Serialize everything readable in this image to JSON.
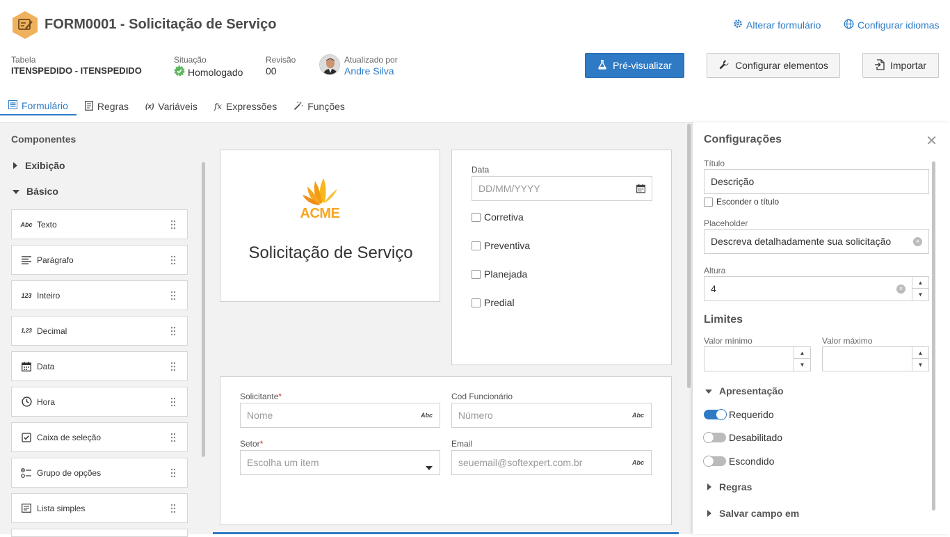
{
  "header": {
    "title": "FORM0001 - Solicitação de Serviço",
    "links": {
      "alterar": "Alterar formulário",
      "idiomas": "Configurar idiomas"
    },
    "table_label": "Tabela",
    "table_value": "ITENSPEDIDO - ITENSPEDIDO",
    "status_label": "Situação",
    "status_value": "Homologado",
    "revision_label": "Revisão",
    "revision_value": "00",
    "updated_label": "Atualizado por",
    "updated_value": "Andre Silva",
    "buttons": {
      "preview": "Pré-visualizar",
      "configure": "Configurar elementos",
      "import": "Importar"
    }
  },
  "tabs": [
    {
      "label": "Formulário",
      "icon": "form-icon"
    },
    {
      "label": "Regras",
      "icon": "rules-icon"
    },
    {
      "label": "Variáveis",
      "icon": "variables-icon"
    },
    {
      "label": "Expressões",
      "icon": "fx-icon"
    },
    {
      "label": "Funções",
      "icon": "magic-wand-icon"
    }
  ],
  "sidebar": {
    "title": "Componentes",
    "groups": {
      "exibicao": "Exibição",
      "basico": "Básico"
    },
    "components": [
      {
        "label": "Texto",
        "icon_text": "Abc"
      },
      {
        "label": "Parágrafo",
        "icon_text": ""
      },
      {
        "label": "Inteiro",
        "icon_text": "123"
      },
      {
        "label": "Decimal",
        "icon_text": "1,23"
      },
      {
        "label": "Data",
        "icon_text": ""
      },
      {
        "label": "Hora",
        "icon_text": ""
      },
      {
        "label": "Caixa de seleção",
        "icon_text": ""
      },
      {
        "label": "Grupo de opções",
        "icon_text": ""
      },
      {
        "label": "Lista simples",
        "icon_text": ""
      }
    ]
  },
  "form": {
    "logo_text": "ACME",
    "heading": "Solicitação de Serviço",
    "date_label": "Data",
    "date_placeholder": "DD/MM/YYYY",
    "checkboxes": [
      "Corretiva",
      "Preventiva",
      "Planejada",
      "Predial"
    ],
    "solicitante_label": "Solicitante",
    "solicitante_placeholder": "Nome",
    "cod_label": "Cod Funcionário",
    "cod_placeholder": "Número",
    "setor_label": "Setor",
    "setor_placeholder": "Escolha um item",
    "email_label": "Email",
    "email_placeholder": "seuemail@softexpert.com.br",
    "abc_tag": "Abc",
    "required_mark": "*"
  },
  "config": {
    "title": "Configurações",
    "titulo_label": "Título",
    "titulo_value": "Descrição",
    "hide_title_label": "Esconder o título",
    "placeholder_label": "Placeholder",
    "placeholder_value": "Descreva detalhadamente sua solicitação",
    "altura_label": "Altura",
    "altura_value": "4",
    "limites_title": "Limites",
    "min_label": "Valor mínimo",
    "max_label": "Valor máximo",
    "apresentacao": "Apresentação",
    "toggles": [
      {
        "label": "Requerido",
        "on": true
      },
      {
        "label": "Desabilitado",
        "on": false
      },
      {
        "label": "Escondido",
        "on": false
      }
    ],
    "regras": "Regras",
    "salvar": "Salvar campo em"
  },
  "colors": {
    "accent": "#2f7ac4",
    "logo_orange": "#f5a623",
    "status_green": "#5cb85c"
  }
}
